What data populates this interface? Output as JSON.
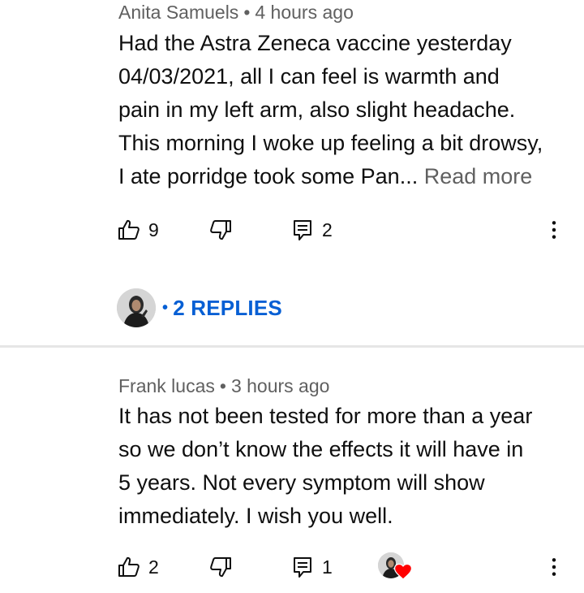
{
  "comments": [
    {
      "author": "Anita Samuels",
      "separator": "•",
      "time": "4 hours ago",
      "lines": [
        "Had the Astra Zeneca vaccine yesterday",
        "04/03/2021, all I can feel is warmth and",
        "pain in my left arm, also slight headache.",
        "This morning I woke up feeling a bit drowsy,",
        "I ate porridge took some Pan... "
      ],
      "read_more": "Read more",
      "likes": "9",
      "replies_count": "2",
      "replies_link": "2 REPLIES",
      "replies_bullet": "•"
    },
    {
      "author": "Frank lucas",
      "separator": "•",
      "time": "3 hours ago",
      "lines": [
        "It has not been tested for more than a year",
        "so we don’t know the effects it will have in",
        "5 years. Not every symptom will show",
        "immediately. I wish you well."
      ],
      "likes": "2",
      "replies_count": "1"
    }
  ],
  "icons": {
    "like": "thumb-up-icon",
    "dislike": "thumb-down-icon",
    "reply": "reply-icon",
    "more": "more-vert-icon",
    "heart": "heart-icon"
  },
  "colors": {
    "link_blue": "#065fd4",
    "meta_gray": "#606060",
    "heart_red": "#ff0000"
  }
}
